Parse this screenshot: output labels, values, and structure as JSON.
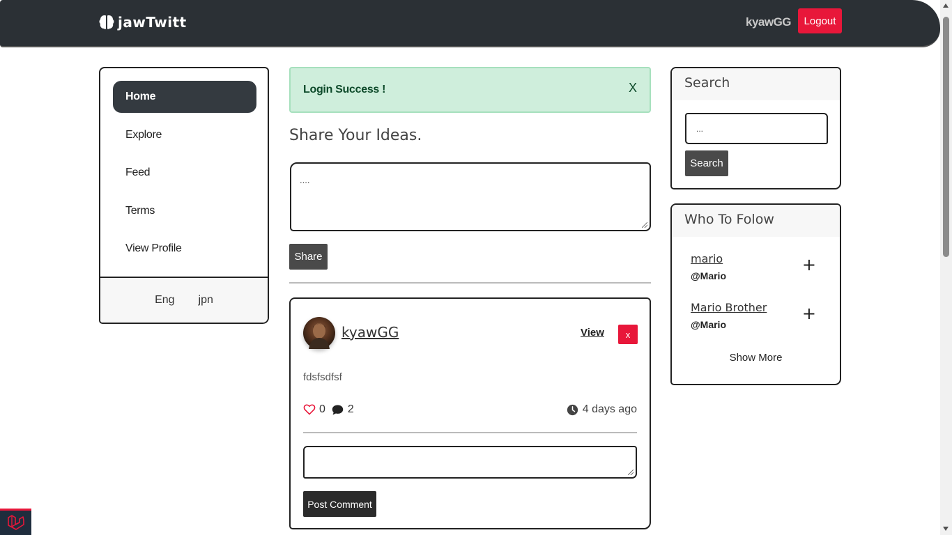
{
  "navbar": {
    "brand": "jawTwitt",
    "username": "kyawGG",
    "logout_label": "Logout"
  },
  "sidebar": {
    "items": [
      {
        "label": "Home",
        "active": true
      },
      {
        "label": "Explore",
        "active": false
      },
      {
        "label": "Feed",
        "active": false
      },
      {
        "label": "Terms",
        "active": false
      },
      {
        "label": "View Profile",
        "active": false
      }
    ],
    "languages": [
      "Eng",
      "jpn"
    ]
  },
  "alert": {
    "message": "Login Success !",
    "close_label": "X",
    "color": "#cfeedc"
  },
  "share": {
    "title": "Share Your Ideas.",
    "textarea_value": "....",
    "button_label": "Share"
  },
  "post": {
    "author": "kyawGG",
    "view_label": "View",
    "delete_label": "x",
    "body": "fdsfsdfsf",
    "likes": "0",
    "comments": "2",
    "time": "4 days ago",
    "comment_button_label": "Post Comment"
  },
  "search": {
    "title": "Search",
    "input_value": "...",
    "button_label": "Search"
  },
  "who_to_follow": {
    "title": "Who To Folow",
    "users": [
      {
        "name": "mario",
        "handle": "@Mario"
      },
      {
        "name": "Mario Brother",
        "handle": "@Mario"
      }
    ],
    "add_label": "+",
    "show_more_label": "Show More"
  },
  "colors": {
    "navbar": "#2b3035",
    "danger": "#e8173a",
    "dark_button": "#4a4a4a"
  }
}
